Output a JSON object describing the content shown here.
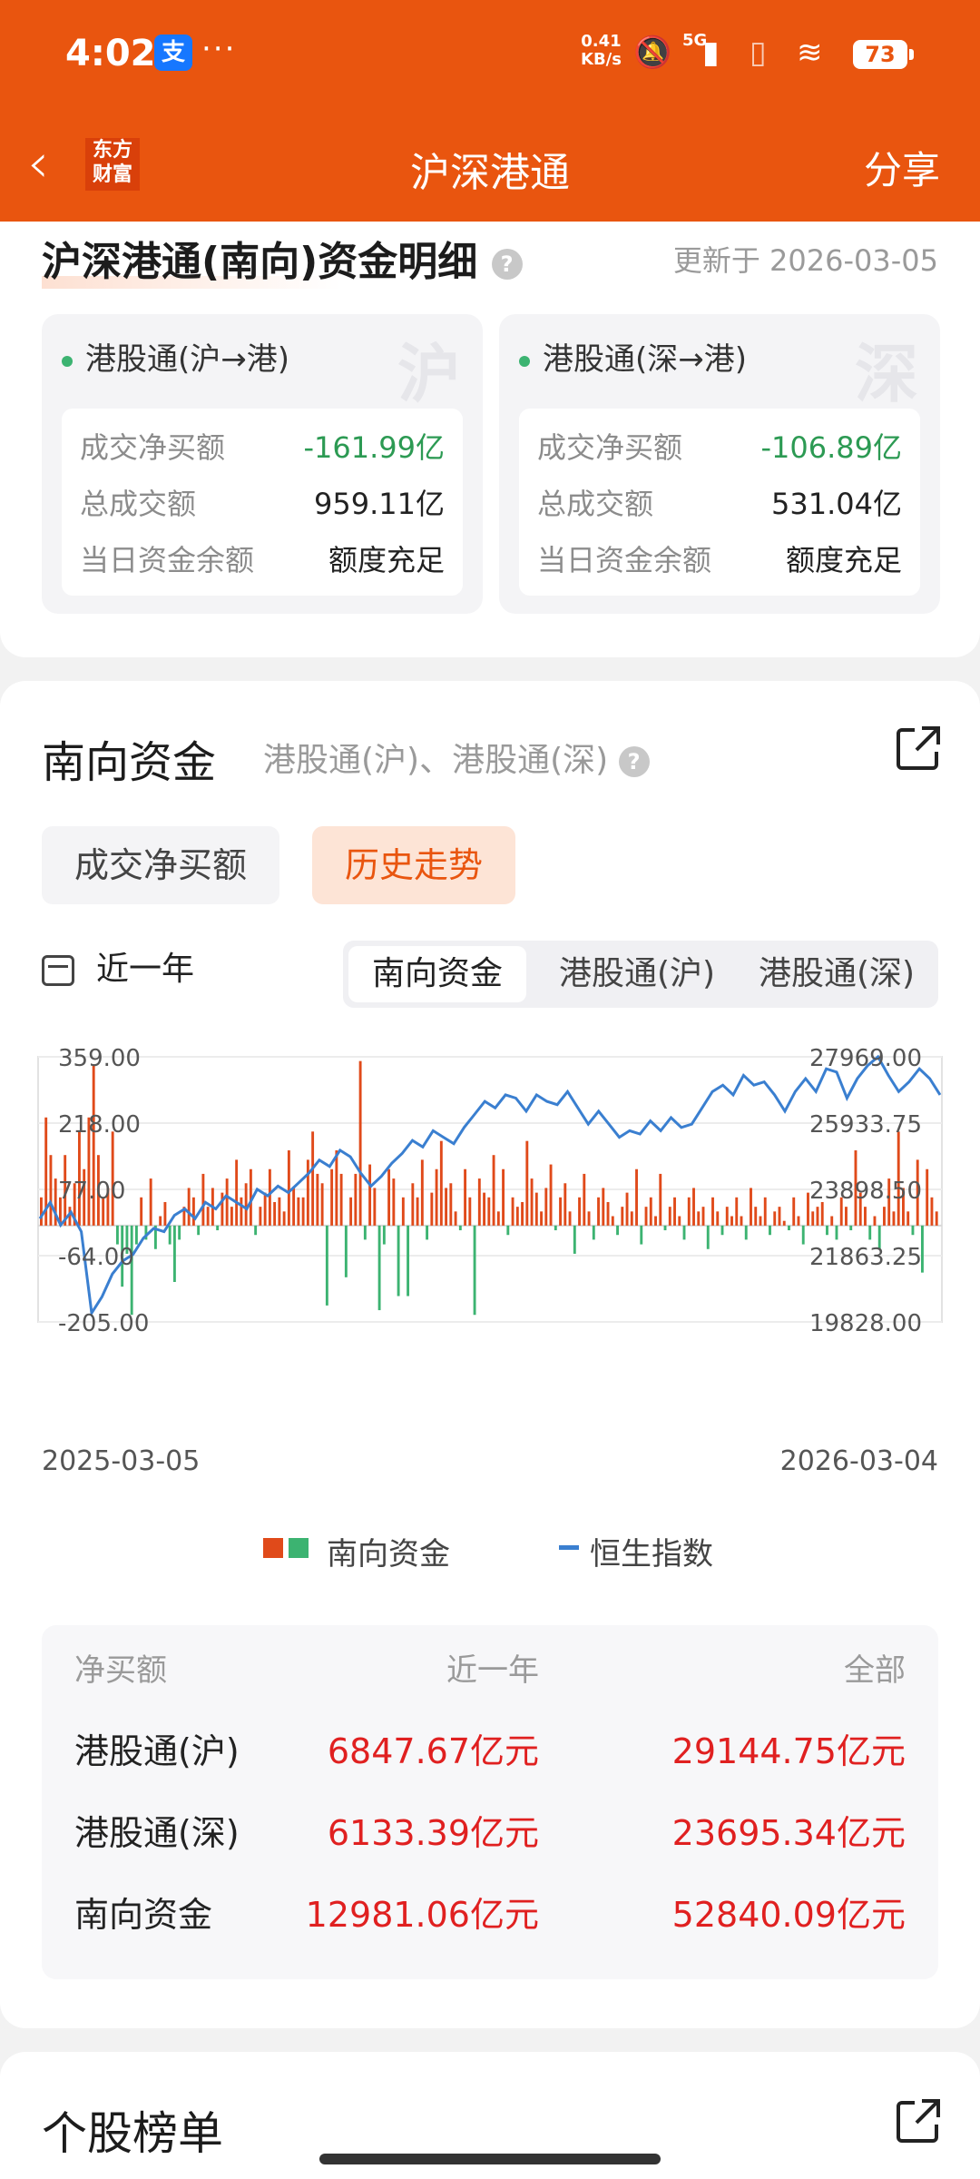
{
  "status": {
    "time": "4:02",
    "speed_value": "0.41",
    "speed_unit": "KB/s",
    "network": "5G",
    "battery": "73"
  },
  "nav": {
    "back_icon": "chevron-left-icon",
    "brand_line1": "东方",
    "brand_line2": "财富",
    "title": "沪深港通",
    "share": "分享"
  },
  "detail": {
    "title": "沪深港通(南向)资金明细",
    "help": "?",
    "updated": "更新于 2026-03-05",
    "panels": [
      {
        "title": "港股通(沪→港)",
        "watermark": "沪",
        "net_buy_label": "成交净买额",
        "net_buy": "-161.99亿",
        "total_label": "总成交额",
        "total": "959.11亿",
        "balance_label": "当日资金余额",
        "balance": "额度充足"
      },
      {
        "title": "港股通(深→港)",
        "watermark": "深",
        "net_buy_label": "成交净买额",
        "net_buy": "-106.89亿",
        "total_label": "总成交额",
        "total": "531.04亿",
        "balance_label": "当日资金余额",
        "balance": "额度充足"
      }
    ]
  },
  "southbound": {
    "title": "南向资金",
    "subtitle": "港股通(沪)、港股通(深)",
    "help": "?",
    "seg_a": "成交净买额",
    "seg_b": "历史走势",
    "range": "近一年",
    "tabs": [
      "南向资金",
      "港股通(沪)",
      "港股通(深)"
    ],
    "legend_bar": "南向资金",
    "legend_line": "恒生指数",
    "table": {
      "headers": [
        "净买额",
        "近一年",
        "全部"
      ],
      "rows": [
        [
          "港股通(沪)",
          "6847.67亿元",
          "29144.75亿元"
        ],
        [
          "港股通(深)",
          "6133.39亿元",
          "23695.34亿元"
        ],
        [
          "南向资金",
          "12981.06亿元",
          "52840.09亿元"
        ]
      ]
    }
  },
  "stocks": {
    "title": "个股榜单"
  },
  "colors": {
    "brand": "#e9550f",
    "up": "#e02020",
    "down": "#2c9a53",
    "line": "#3a7fd0"
  },
  "chart_data": {
    "type": "bar",
    "x_start": "2025-03-05",
    "x_end": "2026-03-04",
    "left_axis": {
      "ticks": [
        "359.00",
        "218.00",
        "77.00",
        "-64.00",
        "-205.00"
      ],
      "ylim": [
        -205,
        359
      ]
    },
    "right_axis": {
      "ticks": [
        "27969.00",
        "25933.75",
        "23898.50",
        "21863.25",
        "19828.00"
      ],
      "ylim": [
        19828,
        27969
      ]
    },
    "series": [
      {
        "name": "南向资金",
        "type": "bar",
        "values": [
          60,
          230,
          150,
          100,
          60,
          150,
          40,
          90,
          200,
          120,
          230,
          340,
          150,
          60,
          80,
          200,
          -40,
          -130,
          -60,
          -190,
          -40,
          60,
          -30,
          100,
          -50,
          20,
          50,
          -40,
          -120,
          -30,
          40,
          80,
          60,
          -20,
          110,
          40,
          80,
          -10,
          70,
          100,
          40,
          140,
          60,
          90,
          120,
          -20,
          40,
          70,
          120,
          50,
          60,
          30,
          160,
          80,
          60,
          60,
          140,
          200,
          110,
          90,
          -170,
          120,
          160,
          110,
          -110,
          60,
          110,
          350,
          -30,
          130,
          80,
          -180,
          -40,
          120,
          100,
          -150,
          60,
          -150,
          90,
          60,
          140,
          -30,
          70,
          120,
          180,
          80,
          90,
          30,
          -10,
          120,
          60,
          -190,
          100,
          70,
          60,
          150,
          30,
          120,
          -20,
          60,
          40,
          50,
          180,
          100,
          70,
          30,
          80,
          130,
          -10,
          60,
          90,
          30,
          -60,
          60,
          110,
          30,
          -30,
          60,
          80,
          50,
          20,
          -20,
          40,
          70,
          30,
          120,
          -40,
          40,
          60,
          20,
          110,
          -10,
          40,
          60,
          20,
          -30,
          60,
          80,
          30,
          40,
          -50,
          60,
          30,
          -20,
          40,
          20,
          60,
          20,
          -30,
          80,
          40,
          20,
          60,
          -20,
          30,
          40,
          10,
          -10,
          60,
          20,
          -40,
          70,
          30,
          40,
          50,
          -20,
          20,
          -30,
          60,
          40,
          -10,
          160,
          70,
          40,
          -30,
          20,
          -50,
          40,
          100,
          30,
          200,
          80,
          30,
          -20,
          140,
          -100,
          120,
          60,
          30
        ]
      },
      {
        "name": "恒生指数",
        "type": "line",
        "values": [
          23000,
          23500,
          22800,
          23200,
          22600,
          20100,
          20600,
          21300,
          21700,
          21900,
          22400,
          22700,
          22600,
          23100,
          23300,
          23000,
          23500,
          23300,
          23700,
          23500,
          23300,
          23900,
          23700,
          24000,
          23800,
          24100,
          24400,
          24800,
          24600,
          25100,
          24900,
          24400,
          24000,
          24300,
          24700,
          25000,
          25400,
          25200,
          25700,
          25500,
          25300,
          25800,
          26200,
          26600,
          26400,
          26800,
          26700,
          26300,
          26800,
          26600,
          26500,
          26900,
          26400,
          25900,
          26300,
          25900,
          25500,
          25700,
          25600,
          26000,
          25700,
          26100,
          25800,
          25900,
          26400,
          26900,
          27100,
          26800,
          27400,
          27100,
          27200,
          26800,
          26300,
          26900,
          27300,
          26900,
          27600,
          27500,
          26700,
          27300,
          27700,
          27969,
          27400,
          26900,
          27200,
          27600,
          27300,
          26800
        ]
      }
    ]
  }
}
